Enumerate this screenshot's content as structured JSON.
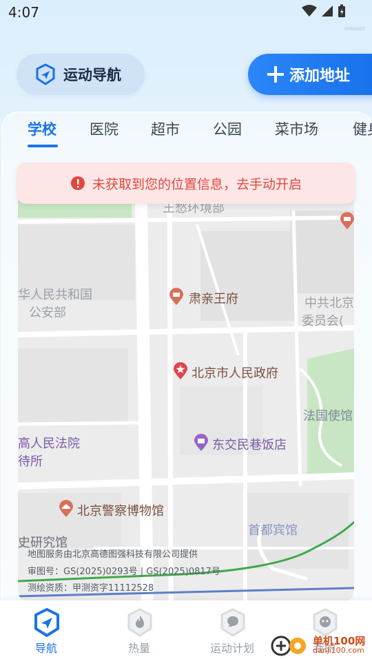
{
  "status_bar": {
    "time": "4:07",
    "build_id": "d86dd02"
  },
  "header": {
    "nav_label": "运动导航",
    "add_label": "添加地址"
  },
  "tabs": [
    {
      "label": "学校",
      "active": true
    },
    {
      "label": "医院",
      "active": false
    },
    {
      "label": "超市",
      "active": false
    },
    {
      "label": "公园",
      "active": false
    },
    {
      "label": "菜市场",
      "active": false
    },
    {
      "label": "健身",
      "active": false
    }
  ],
  "warning": {
    "text": "未获取到您的位置信息，去手动开启"
  },
  "map": {
    "labels": {
      "top_partial": "王愁环境部",
      "ministry_line1": "华人民共和国",
      "ministry_line2": "公安部",
      "prince_mansion": "肃亲王府",
      "committee_line1": "中共北京",
      "committee_line2": "委员会(",
      "gov": "北京市人民政府",
      "french_embassy": "法国使馆",
      "court_line1": "高人民法院",
      "court_line2": "待所",
      "restaurant": "东交民巷饭店",
      "police_museum": "北京警察博物馆",
      "hotel": "首都宾馆",
      "research": "史研究馆"
    },
    "credits": [
      "地图服务由北京高德图强科技有限公司提供",
      "审图号：GS(2025)0293号 | GS(2025)0817号",
      "测绘资质：甲测资字11112528"
    ]
  },
  "bottom_nav": [
    {
      "label": "导航",
      "icon": "navigation-icon",
      "active": true
    },
    {
      "label": "热量",
      "icon": "flame-icon",
      "active": false
    },
    {
      "label": "运动计划",
      "icon": "chat-icon",
      "active": false
    },
    {
      "label": "我的",
      "icon": "profile-icon",
      "active": false
    }
  ],
  "watermark": {
    "top": "单机100网",
    "bottom": "danji100.com"
  },
  "colors": {
    "accent": "#1a73e8",
    "warning_text": "#e0483e",
    "warning_bg": "#fde6e6",
    "map_park": "#c8e6c4"
  }
}
